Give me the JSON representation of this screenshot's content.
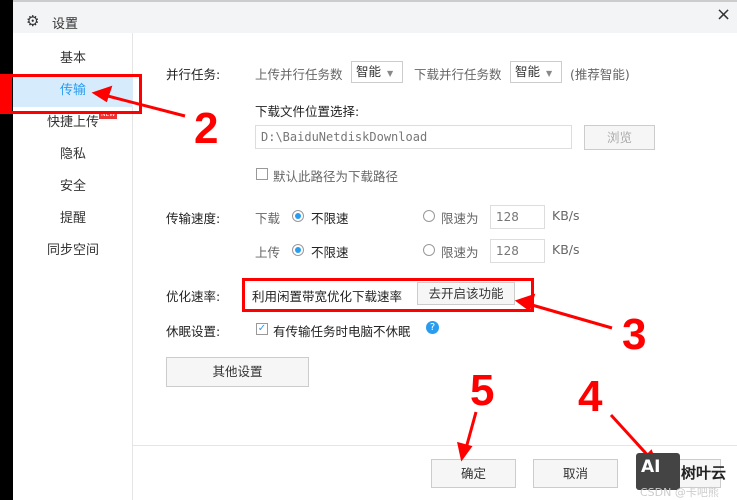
{
  "window": {
    "title": "设置",
    "icon": "gear-icon",
    "close": "×"
  },
  "nav": {
    "items": [
      {
        "label": "基本"
      },
      {
        "label": "传输"
      },
      {
        "label": "快捷上传"
      },
      {
        "label": "隐私"
      },
      {
        "label": "安全"
      },
      {
        "label": "提醒"
      },
      {
        "label": "同步空间"
      }
    ],
    "selected": "传输",
    "new_badge": "NEW"
  },
  "parallel": {
    "label": "并行任务:",
    "upload_label": "上传并行任务数",
    "upload_value": "智能",
    "download_label": "下载并行任务数",
    "download_value": "智能",
    "hint": "(推荐智能)"
  },
  "download_location": {
    "label": "下载文件位置选择:",
    "path": "D:\\BaiduNetdiskDownload",
    "browse": "浏览",
    "default_checkbox": "默认此路径为下载路径",
    "default_checked": false
  },
  "speed": {
    "label": "传输速度:",
    "download": {
      "label": "下载",
      "unlimited": "不限速",
      "limit": "限速为",
      "value": "128",
      "unit": "KB/s",
      "selected": "unlimited"
    },
    "upload": {
      "label": "上传",
      "unlimited": "不限速",
      "limit": "限速为",
      "value": "128",
      "unit": "KB/s",
      "selected": "unlimited"
    }
  },
  "optimize": {
    "label": "优化速率:",
    "text": "利用闲置带宽优化下载速率",
    "button": "去开启该功能"
  },
  "sleep": {
    "label": "休眠设置:",
    "checkbox": "有传输任务时电脑不休眠",
    "checked": true
  },
  "other_settings": "其他设置",
  "footer": {
    "ok": "确定",
    "cancel": "取消"
  },
  "annotations": [
    "2",
    "3",
    "4",
    "5"
  ],
  "watermark": {
    "logo": "AI",
    "brand": "树叶云",
    "credit": "CSDN @卡吧熊"
  },
  "colors": {
    "accent": "#2a9cf0",
    "annotation": "#ff0000"
  }
}
